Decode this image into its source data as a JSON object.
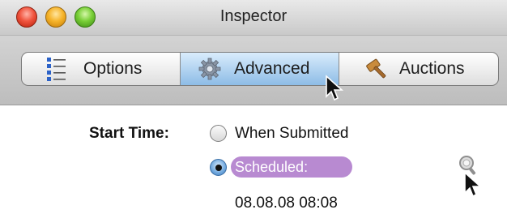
{
  "window": {
    "title": "Inspector"
  },
  "toolbar": {
    "segments": [
      {
        "label": "Options",
        "icon": "checklist-icon",
        "selected": false
      },
      {
        "label": "Advanced",
        "icon": "gear-icon",
        "selected": true
      },
      {
        "label": "Auctions",
        "icon": "gavel-icon",
        "selected": false
      }
    ]
  },
  "form": {
    "start_time_label": "Start Time:",
    "options": [
      {
        "label": "When Submitted",
        "selected": false
      },
      {
        "label": "Scheduled:",
        "selected": true
      }
    ],
    "scheduled_value": "08.08.08 08:08"
  },
  "colors": {
    "selected_segment": "#8dbce6",
    "token": "#b88ad1"
  }
}
